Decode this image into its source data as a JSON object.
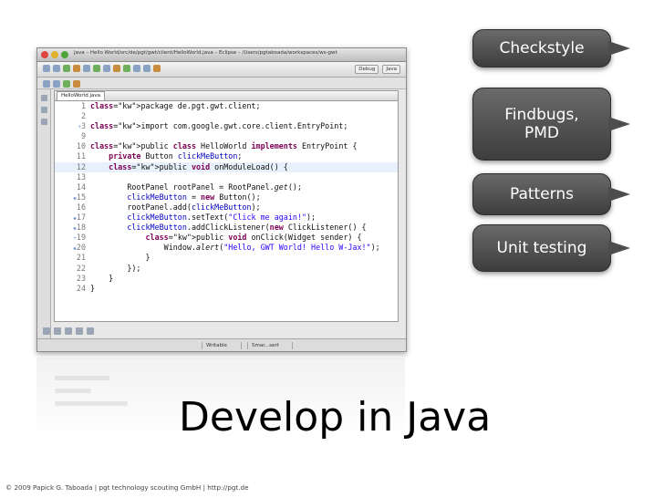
{
  "window": {
    "title": "Java – Hello World/src/de/pgt/gwt/client/HelloWorld.java – Eclipse – /Users/pgtaboada/workspaces/ws-gwt",
    "perspectives": [
      "Debug",
      "Java"
    ]
  },
  "editor": {
    "tab_label": "HelloWorld.java",
    "status_writable": "Writable",
    "status_insert": "Smar...sert"
  },
  "code_lines": [
    {
      "n": "1",
      "m": "",
      "t": "package de.pgt.gwt.client;"
    },
    {
      "n": "2",
      "m": "",
      "t": ""
    },
    {
      "n": "3",
      "m": "+",
      "t": "import com.google.gwt.core.client.EntryPoint;"
    },
    {
      "n": "9",
      "m": "",
      "t": ""
    },
    {
      "n": "10",
      "m": "",
      "t": "public class HelloWorld implements EntryPoint {"
    },
    {
      "n": "11",
      "m": "",
      "t": "    private Button clickMeButton;"
    },
    {
      "n": "12",
      "m": "",
      "t": "    public void onModuleLoad() {"
    },
    {
      "n": "13",
      "m": "",
      "t": ""
    },
    {
      "n": "14",
      "m": "",
      "t": "        RootPanel rootPanel = RootPanel.get();"
    },
    {
      "n": "15",
      "m": "◆",
      "t": "        clickMeButton = new Button();"
    },
    {
      "n": "16",
      "m": "",
      "t": "        rootPanel.add(clickMeButton);"
    },
    {
      "n": "17",
      "m": "◆",
      "t": "        clickMeButton.setText(\"Click me again!\");"
    },
    {
      "n": "18",
      "m": "◆",
      "t": "        clickMeButton.addClickListener(new ClickListener() {"
    },
    {
      "n": "19",
      "m": "+",
      "t": "            public void onClick(Widget sender) {"
    },
    {
      "n": "20",
      "m": "◆",
      "t": "                Window.alert(\"Hello, GWT World! Hello W-Jax!\");"
    },
    {
      "n": "21",
      "m": "",
      "t": "            }"
    },
    {
      "n": "22",
      "m": "",
      "t": "        });"
    },
    {
      "n": "23",
      "m": "",
      "t": "    }"
    },
    {
      "n": "24",
      "m": "",
      "t": "}"
    }
  ],
  "callouts": [
    "Checkstyle",
    "Findbugs,\nPMD",
    "Patterns",
    "Unit testing"
  ],
  "slide": {
    "title": "Develop in Java",
    "footer": "© 2009  Papick G. Taboada | pgt technology scouting GmbH | http://pgt.de"
  }
}
